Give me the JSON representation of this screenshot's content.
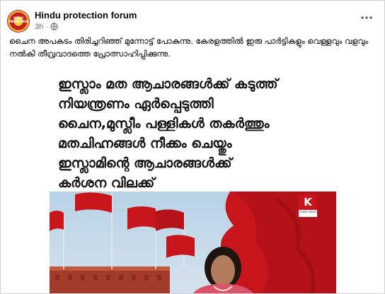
{
  "post": {
    "page_name": "Hindu protection forum",
    "avatar_text": "HINDU PROTECTION",
    "time": "3h",
    "privacy_icon": "globe-icon",
    "more_icon": "more-horizontal-icon",
    "text": "ചൈന അപകടം തിരിച്ചറിഞ്ഞ് മുന്നോട്ട് പോകുന്നു. കേരളത്തിൽ ഇരു പാർട്ടികളും വെള്ളവും വളവും നൽകി തീവ്രവാദത്തെ പ്രോത്സാഹിപ്പിക്കുന്നു."
  },
  "image": {
    "headline": "ഇസ്ലാം മത ആചാരങ്ങൾക്ക് കടുത്ത്\nനിയന്ത്രണം ഏർപ്പെടുത്തി\nചൈന,മുസ്ലീം പള്ളികൾ തകർത്തും\nമതചിഹ്നങ്ങൾ നീക്കം ചെയ്തും\nഇസ്ലാമിന്റെ ആചാരങ്ങൾക്ക്\nകർശന വിലക്ക്",
    "logo_letter": "K",
    "logo_subtext": "KARMA NEWS",
    "colors": {
      "flag_red": "#c8151b",
      "sky": "#c4d9ea",
      "wall": "#a33b2a"
    }
  }
}
